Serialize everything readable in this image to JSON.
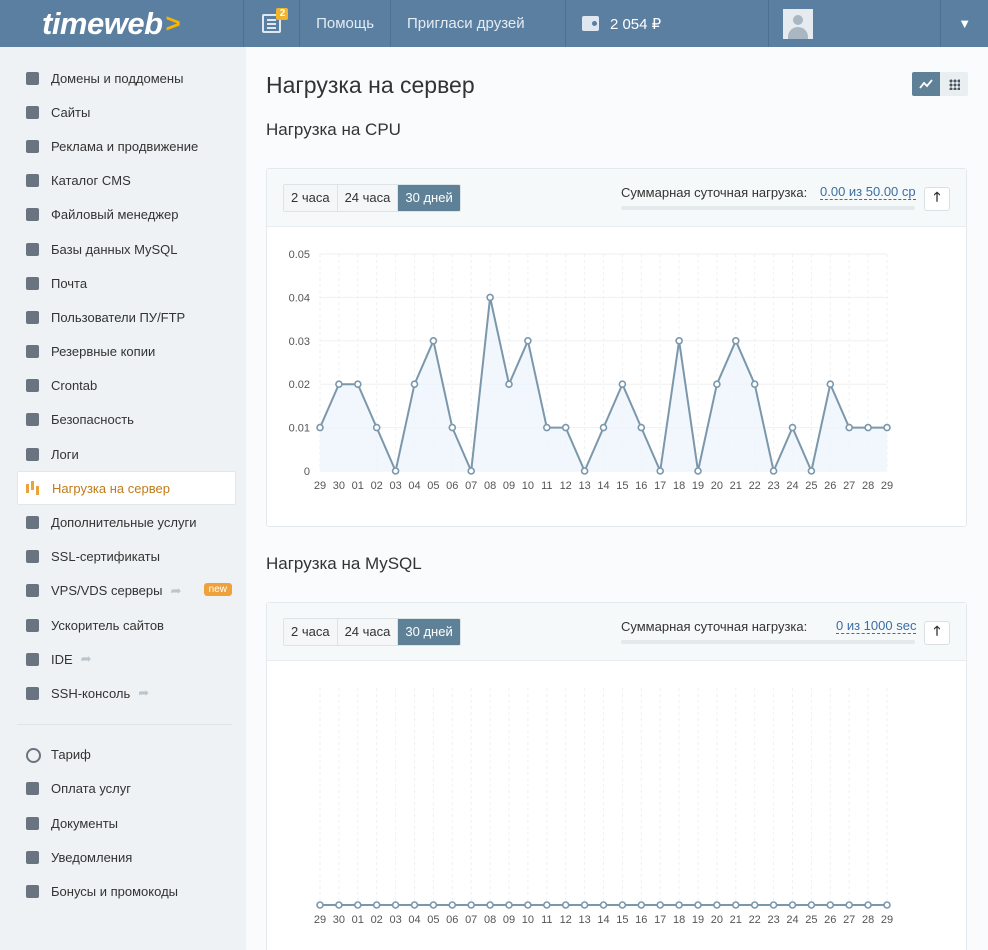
{
  "header": {
    "logo_text": "timeweb",
    "logo_arrow": ">",
    "news_count": "2",
    "help_label": "Помощь",
    "invite_label": "Пригласи друзей",
    "balance": "2 054 ₽",
    "caret": "▼"
  },
  "sidebar": {
    "items": [
      {
        "label": "Домены и поддомены",
        "icon": "sitemap-icon"
      },
      {
        "label": "Сайты",
        "icon": "window-icon"
      },
      {
        "label": "Реклама и продвижение",
        "icon": "trend-chart-icon"
      },
      {
        "label": "Каталог CMS",
        "icon": "briefcase-icon"
      },
      {
        "label": "Файловый менеджер",
        "icon": "folder-icon"
      },
      {
        "label": "Базы данных MySQL",
        "icon": "database-icon"
      },
      {
        "label": "Почта",
        "icon": "mailbox-icon"
      },
      {
        "label": "Пользователи ПУ/FTP",
        "icon": "users-icon"
      },
      {
        "label": "Резервные копии",
        "icon": "server-stack-icon"
      },
      {
        "label": "Crontab",
        "icon": "calendar-clock-icon"
      },
      {
        "label": "Безопасность",
        "icon": "shield-icon"
      },
      {
        "label": "Логи",
        "icon": "log-check-icon"
      },
      {
        "label": "Нагрузка на сервер",
        "icon": "bar-chart-icon"
      },
      {
        "label": "Дополнительные услуги",
        "icon": "badge-check-icon"
      },
      {
        "label": "SSL-сертификаты",
        "icon": "certificate-icon"
      },
      {
        "label": "VPS/VDS серверы",
        "icon": "server-icon",
        "badge": "new"
      },
      {
        "label": "Ускоритель сайтов",
        "icon": "rocket-icon"
      },
      {
        "label": "IDE",
        "icon": "code-file-icon"
      },
      {
        "label": "SSH-консоль",
        "icon": "terminal-icon"
      }
    ],
    "bottom_items": [
      {
        "label": "Тариф",
        "icon": "info-circle-icon"
      },
      {
        "label": "Оплата услуг",
        "icon": "wallet-icon"
      },
      {
        "label": "Документы",
        "icon": "documents-icon"
      },
      {
        "label": "Уведомления",
        "icon": "phone-icon"
      },
      {
        "label": "Бонусы и промокоды",
        "icon": "gift-icon"
      }
    ]
  },
  "main": {
    "title": "Нагрузка на сервер",
    "cpu": {
      "title": "Нагрузка на CPU",
      "tabs": [
        "2 часа",
        "24 часа",
        "30 дней"
      ],
      "sum_label": "Суммарная суточная нагрузка:",
      "sum_value": "0.00 из 50.00 cp"
    },
    "mysql": {
      "title": "Нагрузка на MySQL",
      "tabs": [
        "2 часа",
        "24 часа",
        "30 дней"
      ],
      "sum_label": "Суммарная суточная нагрузка:",
      "sum_value": "0 из 1000 sec"
    }
  },
  "colors": {
    "header_bg": "#5a7fa1",
    "accent": "#5e8197",
    "line": "#7b97ab",
    "fill": "#eef5fb",
    "active_menu": "#c07c1a"
  },
  "chart_data": [
    {
      "type": "line",
      "x": [
        "29",
        "30",
        "01",
        "02",
        "03",
        "04",
        "05",
        "06",
        "07",
        "08",
        "09",
        "10",
        "11",
        "12",
        "13",
        "14",
        "15",
        "16",
        "17",
        "18",
        "19",
        "20",
        "21",
        "22",
        "23",
        "24",
        "25",
        "26",
        "27",
        "28",
        "29"
      ],
      "values": [
        0.01,
        0.02,
        0.02,
        0.01,
        0,
        0.02,
        0.03,
        0.01,
        0,
        0.04,
        0.02,
        0.03,
        0.01,
        0.01,
        0,
        0.01,
        0.02,
        0.01,
        0,
        0.03,
        0,
        0.02,
        0.03,
        0.02,
        0,
        0.01,
        0,
        0.02,
        0.01,
        0.01,
        0.01
      ],
      "yticks": [
        "0",
        "0.01",
        "0.02",
        "0.03",
        "0.04",
        "0.05"
      ],
      "ylim": [
        0,
        0.05
      ],
      "grid": true
    },
    {
      "type": "line",
      "x": [
        "29",
        "30",
        "01",
        "02",
        "03",
        "04",
        "05",
        "06",
        "07",
        "08",
        "09",
        "10",
        "11",
        "12",
        "13",
        "14",
        "15",
        "16",
        "17",
        "18",
        "19",
        "20",
        "21",
        "22",
        "23",
        "24",
        "25",
        "26",
        "27",
        "28",
        "29"
      ],
      "values": [
        0,
        0,
        0,
        0,
        0,
        0,
        0,
        0,
        0,
        0,
        0,
        0,
        0,
        0,
        0,
        0,
        0,
        0,
        0,
        0,
        0,
        0,
        0,
        0,
        0,
        0,
        0,
        0,
        0,
        0,
        0
      ],
      "grid": true
    }
  ]
}
